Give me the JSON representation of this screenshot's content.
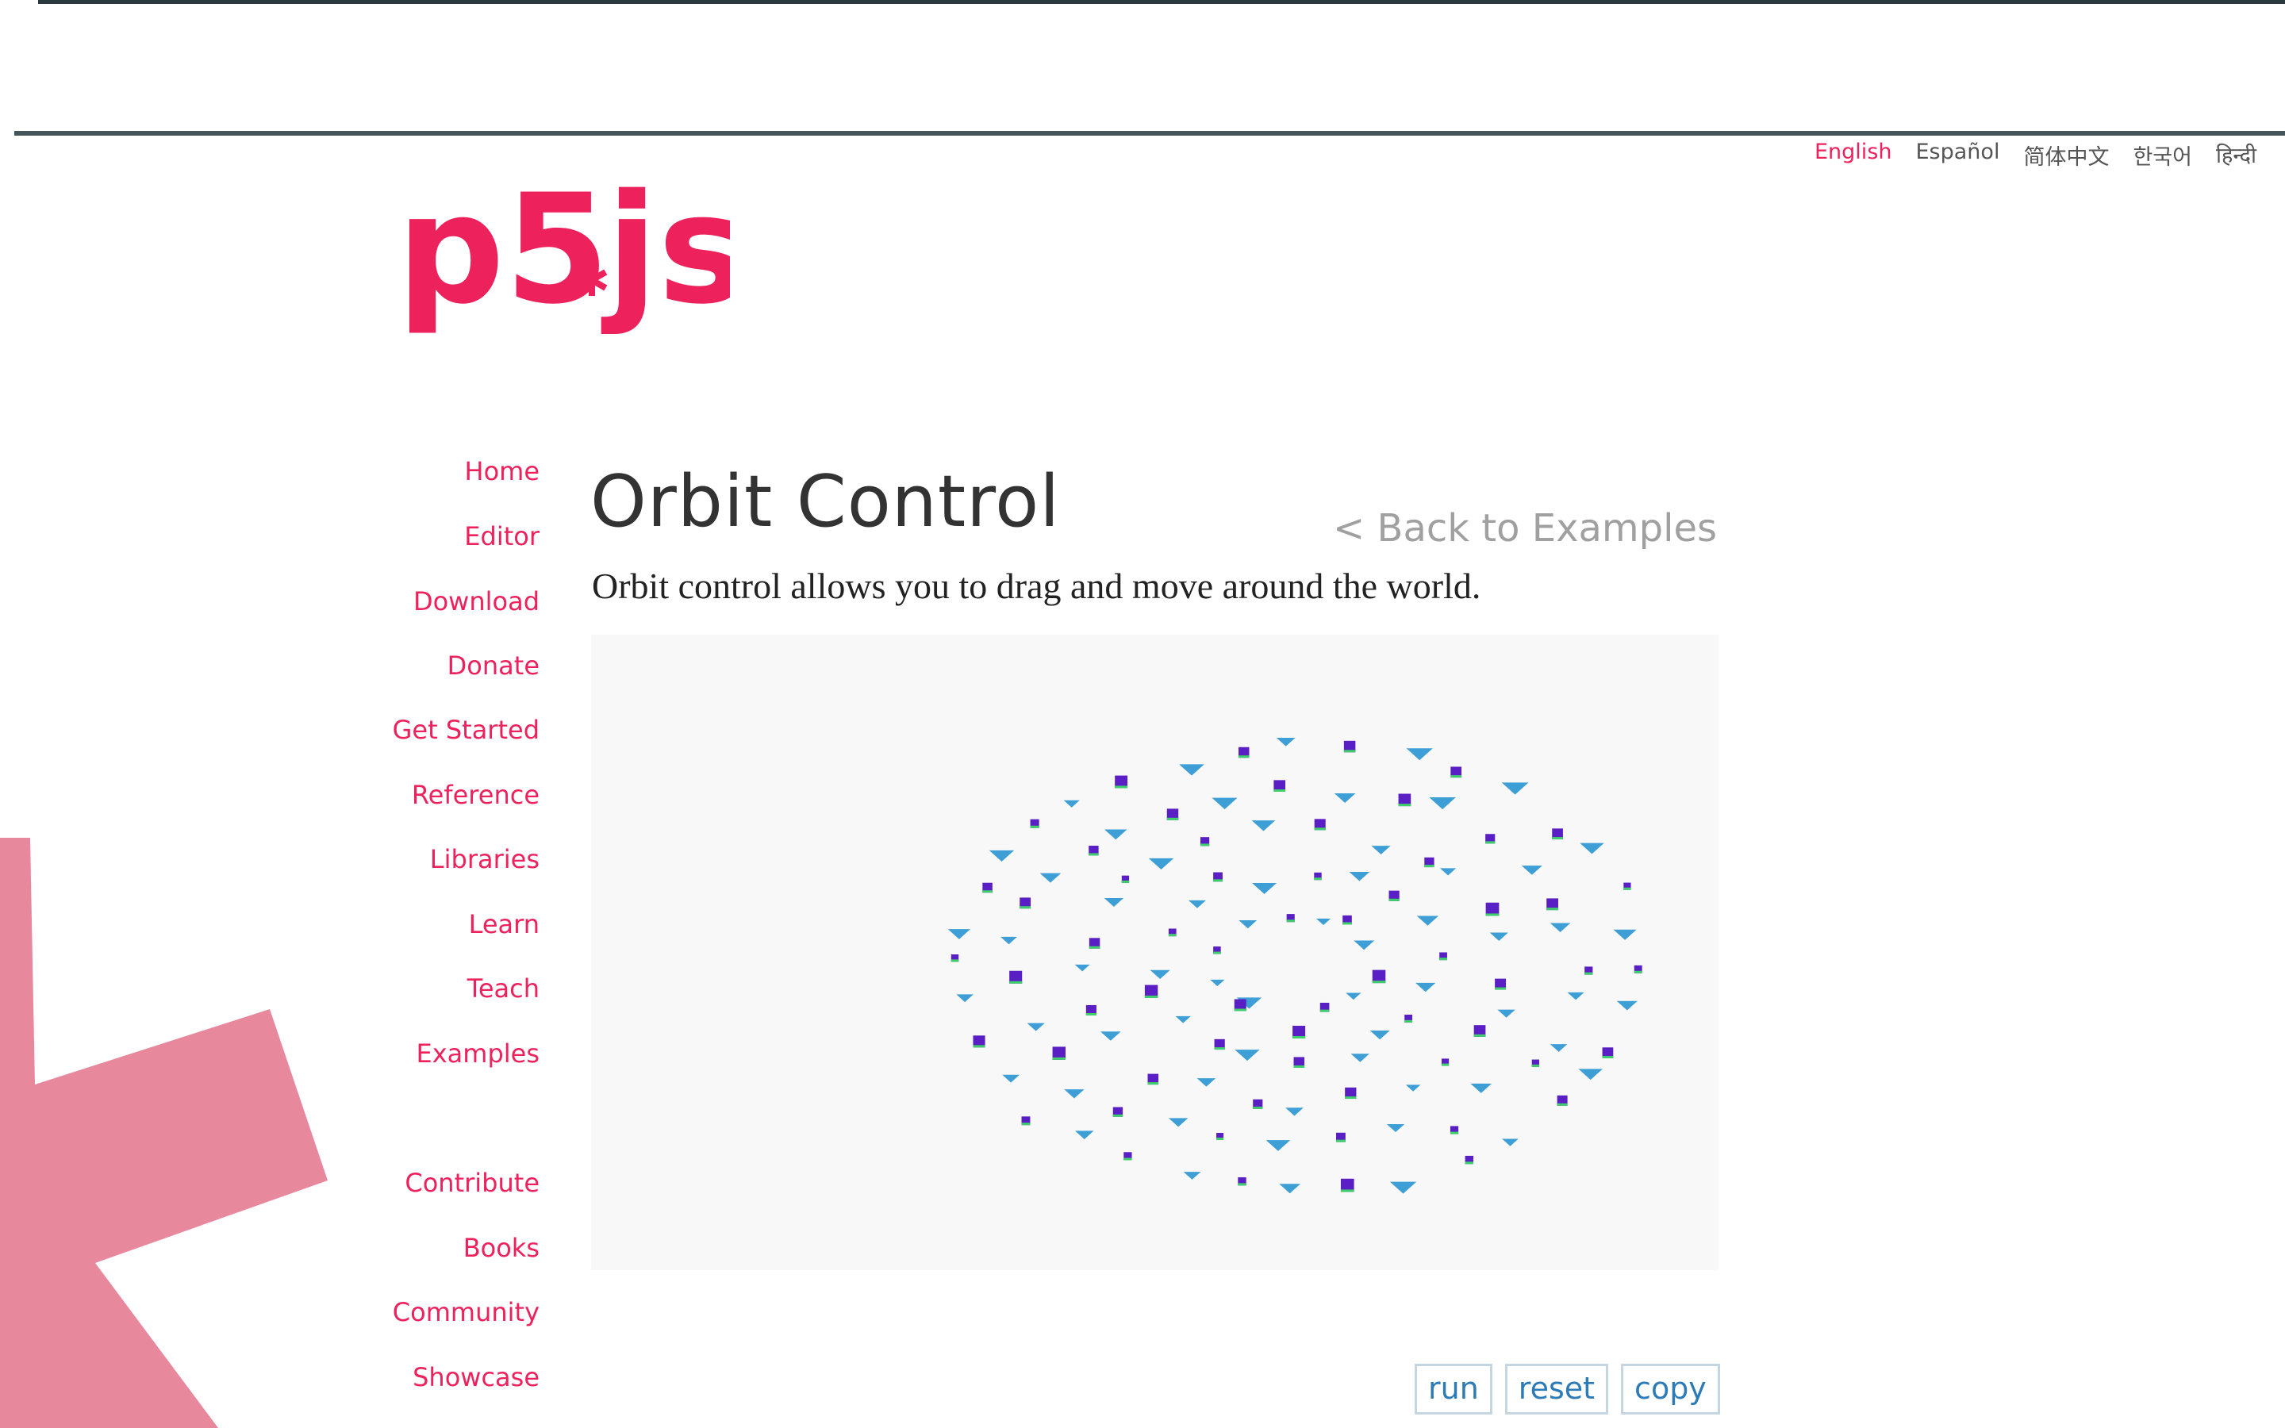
{
  "languages": {
    "english": "English",
    "espanol": "Español",
    "chinese": "简体中文",
    "korean": "한국어",
    "hindi": "हिन्दी",
    "active": "English"
  },
  "logo": {
    "text": "p5",
    "js": "js"
  },
  "sidebar": {
    "items": [
      {
        "label": "Home"
      },
      {
        "label": "Editor"
      },
      {
        "label": "Download"
      },
      {
        "label": "Donate"
      },
      {
        "label": "Get Started"
      },
      {
        "label": "Reference"
      },
      {
        "label": "Libraries"
      },
      {
        "label": "Learn"
      },
      {
        "label": "Teach"
      },
      {
        "label": "Examples"
      },
      {
        "label": "Contribute"
      },
      {
        "label": "Books"
      },
      {
        "label": "Community"
      },
      {
        "label": "Showcase"
      }
    ]
  },
  "main": {
    "title": "Orbit Control",
    "back_link": "< Back to Examples",
    "description": "Orbit control allows you to drag and move around the world."
  },
  "controls": {
    "run": "run",
    "reset": "reset",
    "copy": "copy"
  },
  "colors": {
    "brand": "#ed225d",
    "asterisk": "#e8889d",
    "canvas_bg": "#f8f8f8",
    "button_text": "#2d7bb6",
    "button_border": "#c5d5e2",
    "cube": "#5a1fc4",
    "cone": "#3e9fd6"
  }
}
